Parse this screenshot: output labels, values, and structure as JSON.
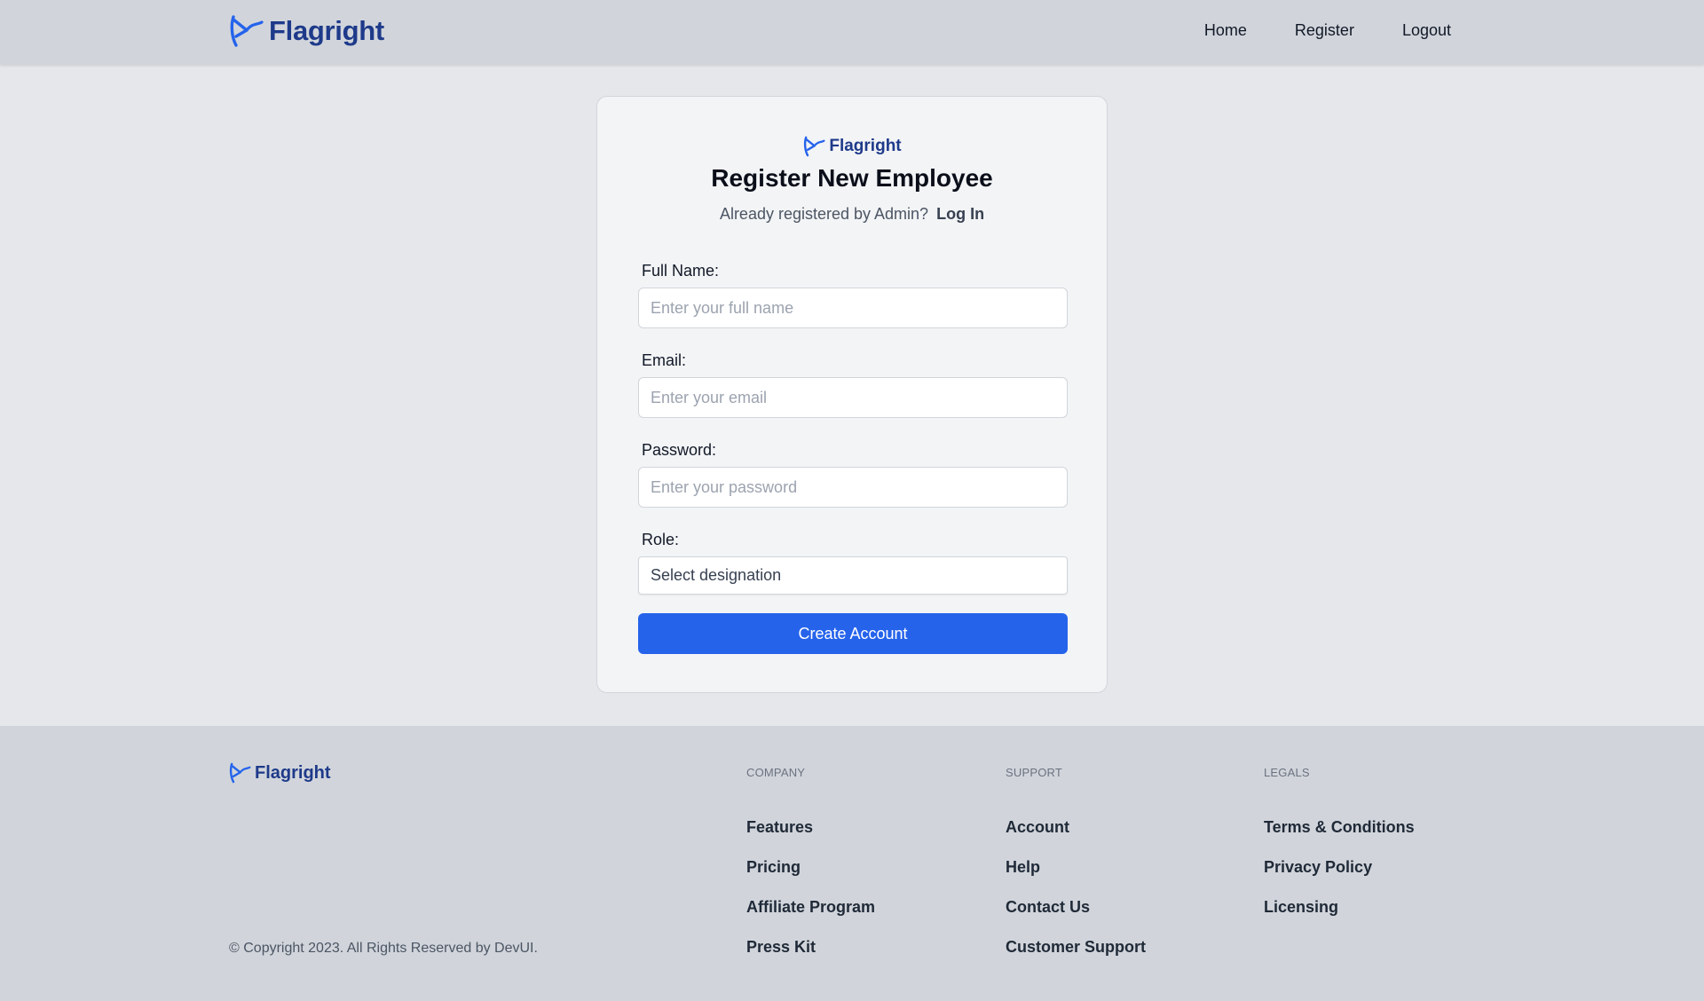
{
  "brand": {
    "name": "Flagright",
    "accent": "#2563eb",
    "dark": "#1e3a8a"
  },
  "nav": {
    "items": [
      "Home",
      "Register",
      "Logout"
    ]
  },
  "form": {
    "title": "Register New Employee",
    "subtitle": "Already registered by Admin?",
    "login_link": "Log In",
    "fields": [
      {
        "label": "Full Name:",
        "placeholder": "Enter your full name"
      },
      {
        "label": "Email:",
        "placeholder": "Enter your email"
      },
      {
        "label": "Password:",
        "placeholder": "Enter your password"
      }
    ],
    "role": {
      "label": "Role:",
      "value": "Select designation"
    },
    "submit_label": "Create Account"
  },
  "footer": {
    "copyright": "© Copyright 2023. All Rights Reserved by DevUI.",
    "columns": [
      {
        "title": "COMPANY",
        "links": [
          "Features",
          "Pricing",
          "Affiliate Program",
          "Press Kit"
        ]
      },
      {
        "title": "SUPPORT",
        "links": [
          "Account",
          "Help",
          "Contact Us",
          "Customer Support"
        ]
      },
      {
        "title": "LEGALS",
        "links": [
          "Terms & Conditions",
          "Privacy Policy",
          "Licensing"
        ]
      }
    ]
  }
}
